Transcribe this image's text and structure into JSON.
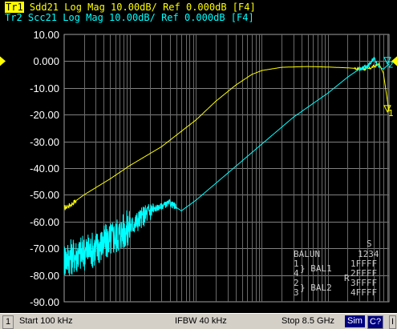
{
  "traces": [
    {
      "tag": "Tr1",
      "text": " Sdd21 Log Mag 10.00dB/ Ref 0.000dB [F4]",
      "color": "#ffff00"
    },
    {
      "tag": "Tr2",
      "text": " Scc21 Log Mag 10.00dB/ Ref 0.000dB [F4]",
      "color": "#00ffff"
    }
  ],
  "y_axis": {
    "labels": [
      "10.00",
      "0.000",
      "-10.00",
      "-20.00",
      "-30.00",
      "-40.00",
      "-50.00",
      "-60.00",
      "-70.00",
      "-80.00",
      "-90.00"
    ],
    "min": -90,
    "max": 10
  },
  "x_axis": {
    "start_hz": 100000,
    "stop_hz": 8500000000,
    "scale": "log"
  },
  "chart_data": {
    "type": "line",
    "xscale": "log",
    "xlim": [
      100000,
      8500000000
    ],
    "ylim": [
      -90,
      10
    ],
    "series": [
      {
        "name": "Sdd21",
        "color": "#ffff00",
        "x": [
          100000,
          120000,
          200000,
          500000,
          1000000,
          3000000,
          10000000,
          20000000,
          40000000,
          70000000,
          100000000,
          200000000,
          500000000,
          1000000000,
          2000000000,
          4000000000,
          5000000000,
          6000000000,
          7000000000,
          8500000000
        ],
        "y": [
          -55,
          -54,
          -50,
          -44,
          -39,
          -32,
          -22,
          -15,
          -9,
          -5,
          -3.5,
          -2.3,
          -2,
          -2.2,
          -2.5,
          -3,
          -2,
          -1,
          -4.5,
          -19
        ]
      },
      {
        "name": "Scc21",
        "color": "#00ffff",
        "x": [
          100000,
          300000,
          1000000,
          2000000,
          4000000,
          6000000,
          10000000,
          30000000,
          100000000,
          300000000,
          1000000000,
          2000000000,
          3000000000,
          4000000000,
          5000000000,
          6000000000,
          7000000000,
          8500000000
        ],
        "y": [
          -74,
          -70,
          -62,
          -56,
          -53,
          -56,
          -52,
          -42,
          -31,
          -21,
          -12,
          -6,
          -3,
          -2,
          1,
          -2,
          -3,
          -1
        ]
      }
    ],
    "markers": [
      {
        "label": "1",
        "trace": "Sdd21"
      },
      {
        "label": "2",
        "trace": "Scc21"
      }
    ]
  },
  "topology": {
    "header": "S",
    "title": "BALUN",
    "ports": "1234",
    "rows": [
      "1FFFF",
      "2FFFF",
      "3FFFF",
      "4FFFF"
    ],
    "r_label": "R",
    "bal1_ports": [
      "1",
      "4"
    ],
    "bal1_label": "} BAL1",
    "bal2_ports": [
      "2",
      "3"
    ],
    "bal2_label": "} BAL2"
  },
  "status": {
    "channel": "1",
    "start": "Start 100 kHz",
    "ifbw": "IFBW 40 kHz",
    "stop": "Stop 8.5 GHz",
    "sim": "Sim",
    "cal": "C?",
    "extra": "I"
  }
}
